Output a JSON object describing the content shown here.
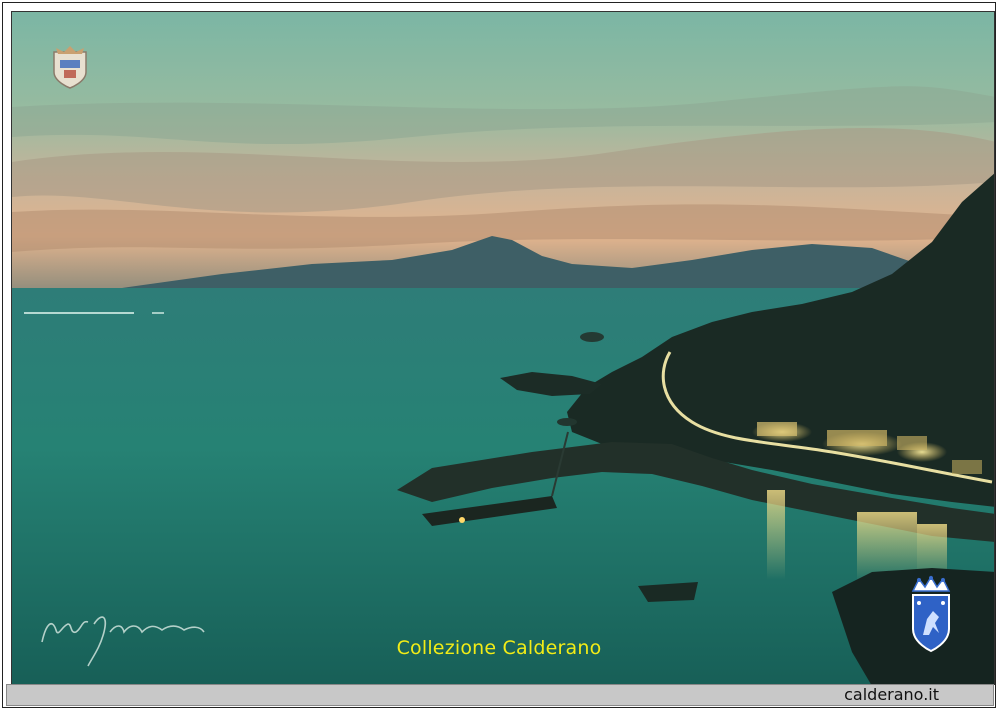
{
  "caption": {
    "text": "Collezione Calderano"
  },
  "footer": {
    "site": "calderano.it"
  },
  "colors": {
    "sea": "#1f7f73",
    "sky_top": "#7fb7a6",
    "sunset_glow": "#e7b88a",
    "caption": "#f2ec16",
    "lights": "#ffd86a"
  },
  "icons": {
    "top_left": "coat-of-arms-icon",
    "bottom_right": "crowned-shield-icon",
    "signature": "handwritten-signature"
  }
}
